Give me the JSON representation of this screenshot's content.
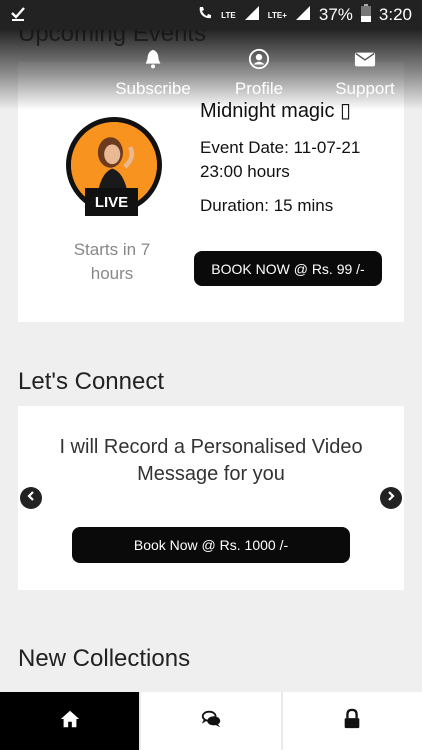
{
  "status_bar": {
    "network_label": "LTE",
    "network_label_2": "LTE+",
    "battery": "37%",
    "time": "3:20"
  },
  "top_nav": {
    "items": [
      {
        "label": "Subscribe",
        "icon": "bell-icon"
      },
      {
        "label": "Profile",
        "icon": "user-icon"
      },
      {
        "label": "Support",
        "icon": "mail-icon"
      }
    ]
  },
  "upcoming": {
    "heading": "Upcoming Events",
    "event": {
      "title": "Midnight magic ▯",
      "badge": "LIVE",
      "starts_in": "Starts in 7 hours",
      "date": "Event Date: 11-07-21 23:00 hours",
      "duration": "Duration: 15 mins",
      "book_label": "BOOK NOW @ Rs. 99 /-"
    }
  },
  "connect": {
    "heading": "Let's Connect",
    "text": "I will Record a Personalised Video Message for you",
    "book_label": "Book Now @ Rs. 1000 /-"
  },
  "collections": {
    "heading": "New Collections"
  },
  "tabbar": {
    "tabs": [
      {
        "icon": "home-icon",
        "active": true
      },
      {
        "icon": "chat-icon",
        "active": false
      },
      {
        "icon": "lock-icon",
        "active": false
      }
    ]
  },
  "colors": {
    "accent": "#0a0a0a",
    "avatar_bg": "#f7931e",
    "background": "#efefef"
  }
}
